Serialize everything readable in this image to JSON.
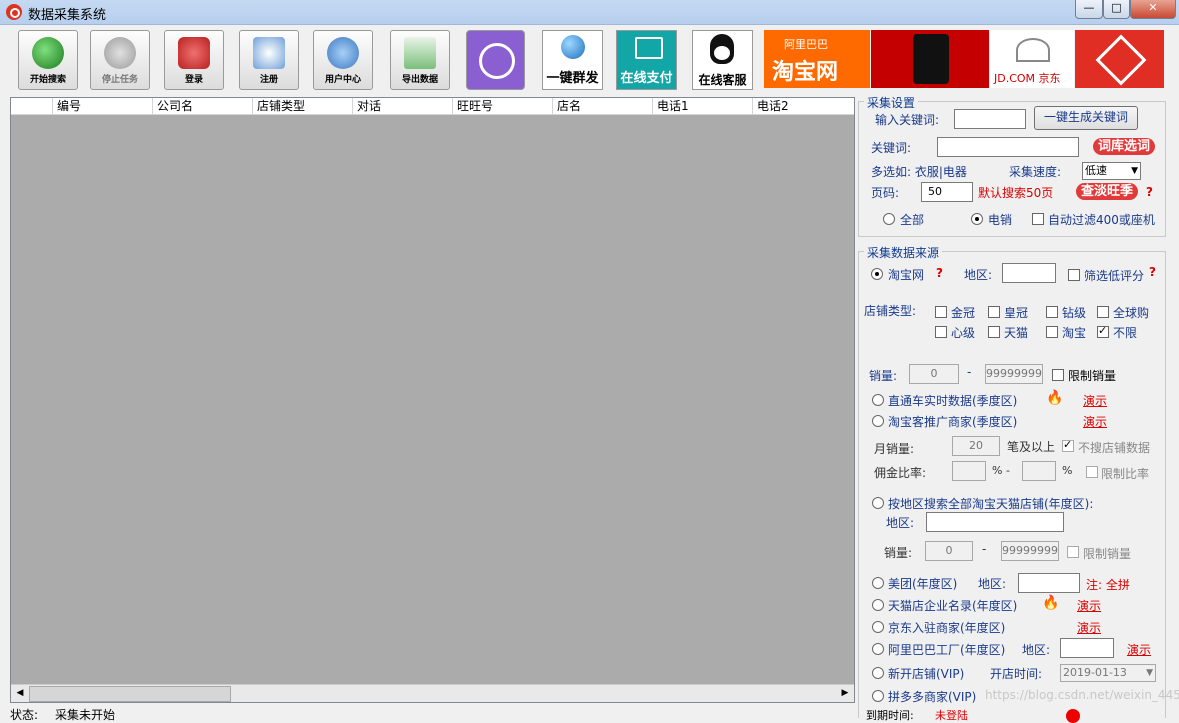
{
  "window": {
    "title": "数据采集系统",
    "min": "—",
    "max": "□",
    "close": "✕"
  },
  "toolbar": {
    "start": "开始搜索",
    "stop": "停止任务",
    "login": "登录",
    "register": "注册",
    "user_center": "用户中心",
    "export": "导出数据",
    "mass_send": "一键群发",
    "pay": "在线支付",
    "service": "在线客服",
    "taobao": "淘宝网",
    "alibaba": "阿里巴巴",
    "jd": "JD.COM 京东"
  },
  "grid": {
    "columns": [
      "编号",
      "公司名",
      "店铺类型",
      "对话",
      "旺旺号",
      "店名",
      "电话1",
      "电话2"
    ]
  },
  "settings": {
    "group_title": "采集设置",
    "keyword_input_label": "输入关键词:",
    "gen_keyword_btn": "一键生成关键词",
    "keyword_label": "关键词:",
    "library_btn": "词库选词",
    "multi_hint": "多选如: 衣服|电器",
    "speed_label": "采集速度:",
    "speed_value": "低速",
    "page_label": "页码:",
    "page_value": "50",
    "default_hint": "默认搜索50页",
    "offseason_btn": "查淡旺季",
    "q": "?",
    "opt_all": "全部",
    "opt_ecom": "电销",
    "auto_filter": "自动过滤400或座机"
  },
  "source": {
    "group_title": "采集数据来源",
    "taobao": "淘宝网",
    "region_label": "地区:",
    "low_score": "筛选低评分",
    "shop_type_label": "店铺类型:",
    "types": [
      "金冠",
      "皇冠",
      "钻级",
      "全球购",
      "心级",
      "天猫",
      "淘宝",
      "不限"
    ],
    "sales_label": "销量:",
    "sales_min": "0",
    "sales_max": "99999999",
    "dash": "-",
    "limit_sales": "限制销量",
    "ztc": "直通车实时数据(季度区)",
    "promo": "淘宝客推广商家(季度区)",
    "demo": "演示",
    "monthly_label": "月销量:",
    "monthly_value": "20",
    "monthly_suffix": "笔及以上",
    "no_shop_data": "不搜店铺数据",
    "commission_label": "佣金比率:",
    "pct": "%",
    "pct_dash": "% -",
    "limit_ratio": "限制比率",
    "region_all": "按地区搜索全部淘宝天猫店铺(年度区):",
    "region_label2": "地区:",
    "sales_label2": "销量:",
    "meituan": "美团(年度区)",
    "meituan_region": "地区:",
    "note": "注: 全拼",
    "tmall_ent": "天猫店企业名录(年度区)",
    "jd_settle": "京东入驻商家(年度区)",
    "ali_factory": "阿里巴巴工厂(年度区)",
    "ali_region": "地区:",
    "new_shop": "新开店铺(VIP)",
    "open_time_label": "开店时间:",
    "open_time": "2019-01-13",
    "pdd": "拼多多商家(VIP)",
    "expire_label": "到期时间:",
    "expire_value": "未登陆",
    "watermark": "https://blog.csdn.net/weixin_44513077"
  },
  "status": {
    "label": "状态:",
    "value": "采集未开始"
  }
}
